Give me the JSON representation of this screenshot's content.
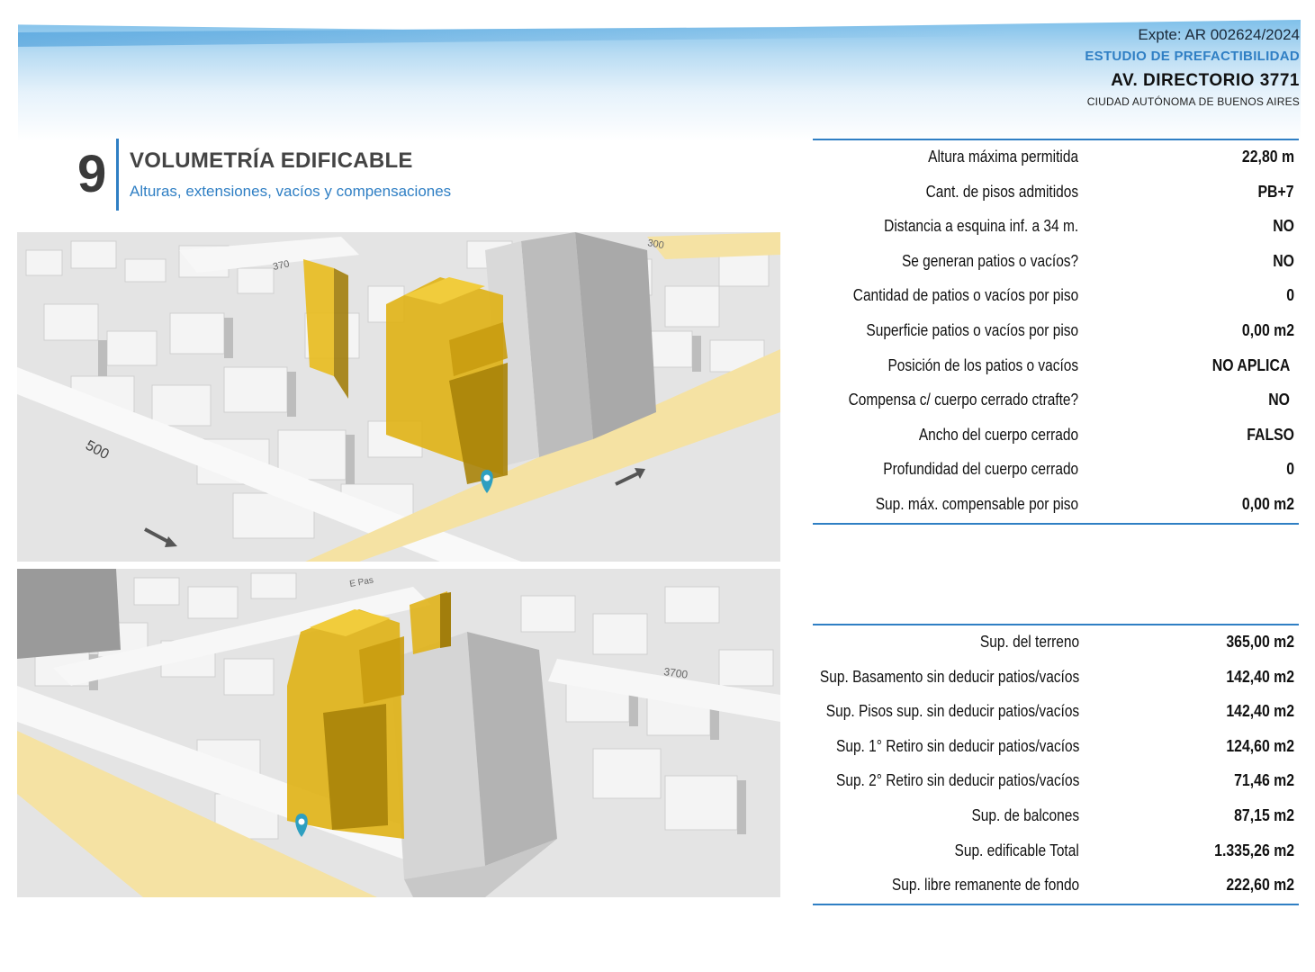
{
  "header": {
    "expediente": "Expte: AR 002624/2024",
    "study": "ESTUDIO DE PREFACTIBILIDAD",
    "address": "AV. DIRECTORIO 3771",
    "city": "CIUDAD AUTÓNOMA DE BUENOS AIRES"
  },
  "section": {
    "number": "9",
    "title": "VOLUMETRÍA EDIFICABLE",
    "subtitle": "Alturas, extensiones, vacíos y compensaciones"
  },
  "maps": {
    "top": {
      "street_labels": [
        "500",
        "370",
        "300"
      ]
    },
    "bottom": {
      "street_labels": [
        "3700",
        "E Pas"
      ]
    }
  },
  "colors": {
    "accent": "#2f7fc4",
    "volume": "#e0b319",
    "road": "#f5e2a3",
    "pin": "#2e9fc0"
  },
  "table1": [
    {
      "label": "Altura máxima permitida",
      "value": "22,80 m"
    },
    {
      "label": "Cant. de pisos admitidos",
      "value": "PB+7"
    },
    {
      "label": "Distancia a esquina inf. a 34 m.",
      "value": "NO"
    },
    {
      "label": "Se generan patios o vacíos?",
      "value": "NO"
    },
    {
      "label": "Cantidad de patios o vacíos por piso",
      "value": "0"
    },
    {
      "label": "Superficie patios o vacíos por piso",
      "value": "0,00 m2"
    },
    {
      "label": "Posición de los patios o vacíos",
      "value": "NO APLICA"
    },
    {
      "label": "Compensa c/ cuerpo cerrado ctrafte?",
      "value": "NO"
    },
    {
      "label": "Ancho del  cuerpo cerrado",
      "value": "FALSO"
    },
    {
      "label": "Profundidad del  cuerpo cerrado",
      "value": "0"
    },
    {
      "label": "Sup. máx. compensable por piso",
      "value": "0,00 m2"
    }
  ],
  "table2": [
    {
      "label": "Sup. del terreno",
      "value": "365,00 m2"
    },
    {
      "label": "Sup. Basamento sin deducir patios/vacíos",
      "value": "142,40 m2"
    },
    {
      "label": "Sup. Pisos sup. sin deducir patios/vacíos",
      "value": "142,40 m2"
    },
    {
      "label": "Sup. 1° Retiro sin deducir patios/vacíos",
      "value": "124,60 m2"
    },
    {
      "label": "Sup. 2° Retiro sin deducir patios/vacíos",
      "value": "71,46 m2"
    },
    {
      "label": "Sup. de balcones",
      "value": "87,15 m2"
    },
    {
      "label": "Sup. edificable Total",
      "value": "1.335,26 m2"
    },
    {
      "label": "Sup. libre remanente de fondo",
      "value": "222,60 m2"
    }
  ]
}
